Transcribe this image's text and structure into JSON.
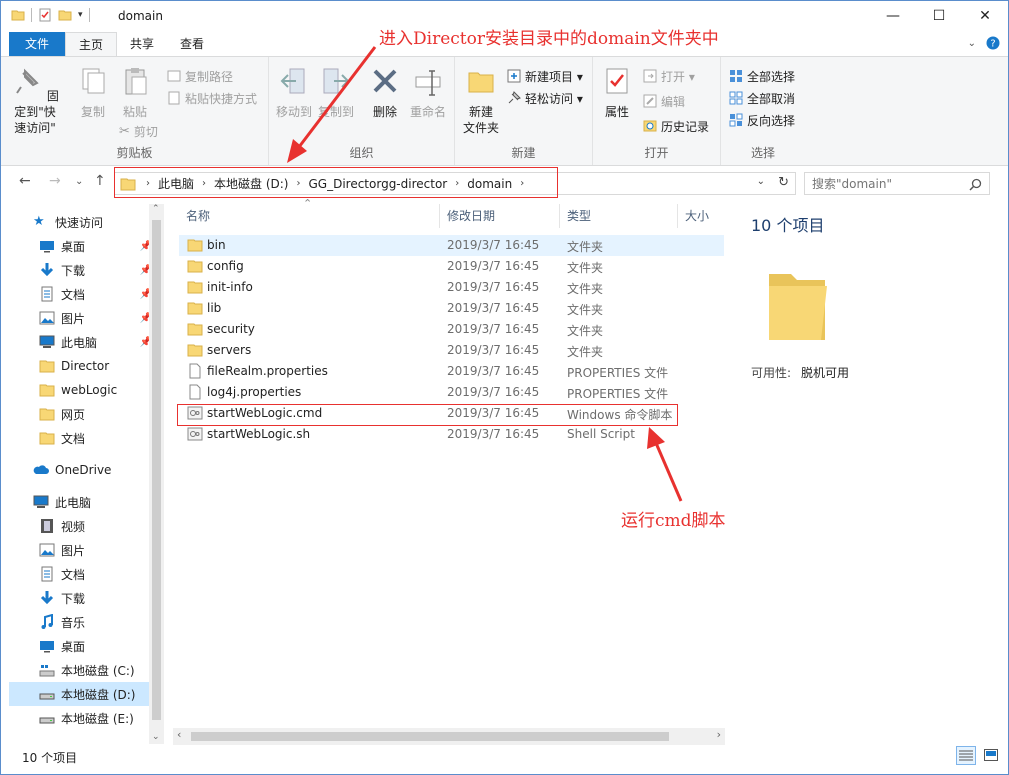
{
  "window": {
    "title": "domain"
  },
  "title_buttons": {
    "minimize": "—",
    "maximize": "☐",
    "close": "✕"
  },
  "tabs": [
    {
      "label": "文件"
    },
    {
      "label": "主页"
    },
    {
      "label": "共享"
    },
    {
      "label": "查看"
    }
  ],
  "ribbon": {
    "clipboard": {
      "label": "剪贴板",
      "pin": "固定到\"快\n速访问\"",
      "copy": "复制",
      "paste": "粘贴",
      "copy_path": "复制路径",
      "paste_shortcut": "粘贴快捷方式",
      "cut": "剪切"
    },
    "organize": {
      "label": "组织",
      "move_to": "移动到",
      "copy_to": "复制到",
      "delete": "删除",
      "rename": "重命名"
    },
    "new": {
      "label": "新建",
      "new_folder": "新建\n文件夹",
      "new_item": "新建项目 ▾",
      "easy_access": "轻松访问 ▾"
    },
    "open": {
      "label": "打开",
      "properties": "属性",
      "open": "打开 ▾",
      "edit": "编辑",
      "history": "历史记录"
    },
    "select": {
      "label": "选择",
      "select_all": "全部选择",
      "select_none": "全部取消",
      "invert": "反向选择"
    }
  },
  "address": {
    "crumbs": [
      "此电脑",
      "本地磁盘 (D:)",
      "GG_Directorgg-director",
      "domain"
    ],
    "search_placeholder": "搜索\"domain\""
  },
  "nav": {
    "quick_access": "快速访问",
    "items": [
      {
        "label": "桌面",
        "icon": "desktop-icon",
        "pinned": true
      },
      {
        "label": "下载",
        "icon": "download-icon",
        "pinned": true
      },
      {
        "label": "文档",
        "icon": "documents-icon",
        "pinned": true
      },
      {
        "label": "图片",
        "icon": "pictures-icon",
        "pinned": true
      },
      {
        "label": "此电脑",
        "icon": "pc-icon",
        "pinned": true
      },
      {
        "label": "Director",
        "icon": "folder-icon"
      },
      {
        "label": "webLogic",
        "icon": "folder-icon"
      },
      {
        "label": "网页",
        "icon": "folder-icon"
      },
      {
        "label": "文档",
        "icon": "folder-icon"
      }
    ],
    "onedrive": "OneDrive",
    "this_pc": "此电脑",
    "pc_items": [
      {
        "label": "视频",
        "icon": "videos-icon"
      },
      {
        "label": "图片",
        "icon": "pictures-icon"
      },
      {
        "label": "文档",
        "icon": "documents-icon"
      },
      {
        "label": "下载",
        "icon": "download-icon"
      },
      {
        "label": "音乐",
        "icon": "music-icon"
      },
      {
        "label": "桌面",
        "icon": "desktop-icon"
      },
      {
        "label": "本地磁盘 (C:)",
        "icon": "drive-c-icon"
      },
      {
        "label": "本地磁盘 (D:)",
        "icon": "drive-icon",
        "selected": true
      },
      {
        "label": "本地磁盘 (E:)",
        "icon": "drive-icon"
      }
    ]
  },
  "columns": {
    "name": "名称",
    "date": "修改日期",
    "type": "类型",
    "size": "大小"
  },
  "files": [
    {
      "name": "bin",
      "date": "2019/3/7 16:45",
      "type": "文件夹",
      "kind": "folder"
    },
    {
      "name": "config",
      "date": "2019/3/7 16:45",
      "type": "文件夹",
      "kind": "folder"
    },
    {
      "name": "init-info",
      "date": "2019/3/7 16:45",
      "type": "文件夹",
      "kind": "folder"
    },
    {
      "name": "lib",
      "date": "2019/3/7 16:45",
      "type": "文件夹",
      "kind": "folder"
    },
    {
      "name": "security",
      "date": "2019/3/7 16:45",
      "type": "文件夹",
      "kind": "folder"
    },
    {
      "name": "servers",
      "date": "2019/3/7 16:45",
      "type": "文件夹",
      "kind": "folder"
    },
    {
      "name": "fileRealm.properties",
      "date": "2019/3/7 16:45",
      "type": "PROPERTIES 文件",
      "kind": "file"
    },
    {
      "name": "log4j.properties",
      "date": "2019/3/7 16:45",
      "type": "PROPERTIES 文件",
      "kind": "file"
    },
    {
      "name": "startWebLogic.cmd",
      "date": "2019/3/7 16:45",
      "type": "Windows 命令脚本",
      "kind": "script"
    },
    {
      "name": "startWebLogic.sh",
      "date": "2019/3/7 16:45",
      "type": "Shell Script",
      "kind": "script"
    }
  ],
  "details": {
    "count": "10 个项目",
    "availability_label": "可用性:",
    "availability_value": "脱机可用"
  },
  "status": {
    "count": "10 个项目"
  },
  "annotations": {
    "top": "进入Director安装目录中的domain文件夹中",
    "bottom": "运行cmd脚本"
  },
  "colors": {
    "accent": "#1979ca",
    "annotation": "#e8312f",
    "folder": "#f8d775",
    "selection": "#cce8ff"
  }
}
